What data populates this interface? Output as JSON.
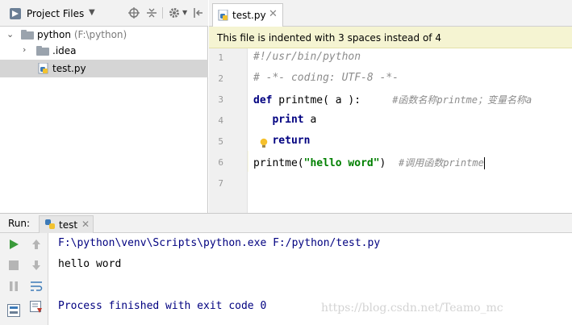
{
  "project_panel": {
    "title": "Project Files",
    "tree": [
      {
        "name": "python",
        "path": "(F:\\python)",
        "kind": "folder",
        "expanded": true
      },
      {
        "name": ".idea",
        "kind": "folder",
        "expanded": false
      },
      {
        "name": "test.py",
        "kind": "python-file",
        "selected": true
      }
    ]
  },
  "editor": {
    "tab_label": "test.py",
    "banner": "This file is indented with 3 spaces instead of 4",
    "line_numbers": [
      "1",
      "2",
      "3",
      "4",
      "5",
      "6",
      "7"
    ],
    "lines": {
      "l1": "#!/usr/bin/python",
      "l2": "# -*- coding: UTF-8 -*-",
      "l3_kw": "def",
      "l3_code": " printme( a ):",
      "l3_comment": "#函数名称printme；变量名称a",
      "l4_kw": "print",
      "l4_code": " a",
      "l5_kw": "return",
      "l6_code_a": "printme(",
      "l6_string": "\"hello word\"",
      "l6_code_b": ")",
      "l6_comment": "#调用函数printme"
    }
  },
  "run_panel": {
    "label": "Run:",
    "tab_label": "test",
    "console": {
      "command": "F:\\python\\venv\\Scripts\\python.exe F:/python/test.py",
      "output": "hello word",
      "exit": "Process finished with exit code 0"
    },
    "watermark": "https://blog.csdn.net/Teamo_mc"
  },
  "colors": {
    "keyword": "#000080",
    "string": "#008000",
    "comment": "#8c8c8c",
    "banner_bg": "#f5f4d2",
    "current_line_bg": "#fcfae1",
    "run_green": "#3a9a3a"
  }
}
